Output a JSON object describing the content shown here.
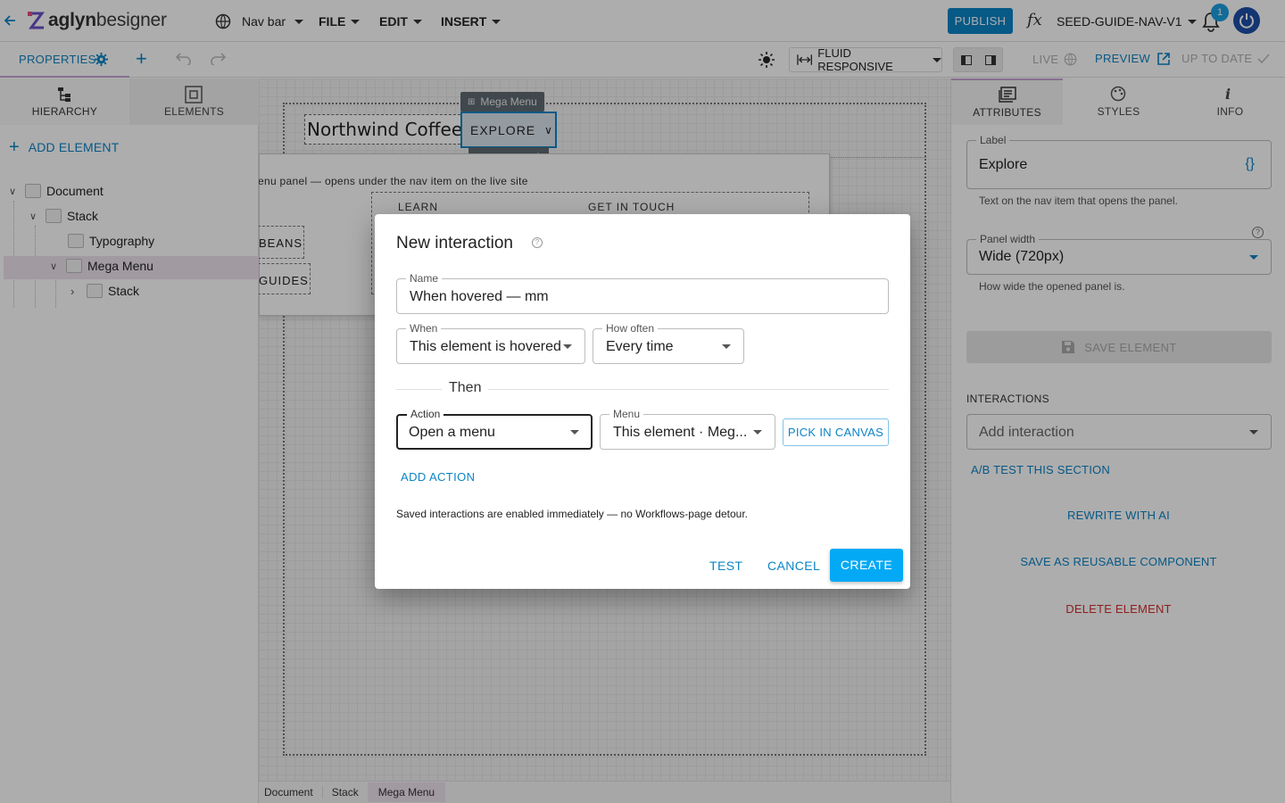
{
  "topbar": {
    "logo_prefix": "aglyn",
    "logo_suffix": "besigner",
    "page_menu": "Nav bar",
    "file": "FILE",
    "edit": "EDIT",
    "insert": "INSERT",
    "publish": "PUBLISH",
    "project": "SEED-GUIDE-NAV-V1",
    "notification_count": "1"
  },
  "toolbar": {
    "properties_tab": "PROPERTIES",
    "responsive_mode": "FLUID RESPONSIVE",
    "live": "LIVE",
    "preview": "PREVIEW",
    "status": "UP TO DATE"
  },
  "left_panel": {
    "tabs": [
      "HIERARCHY",
      "ELEMENTS"
    ],
    "add_element": "ADD ELEMENT",
    "tree": [
      {
        "label": "Document"
      },
      {
        "label": "Stack"
      },
      {
        "label": "Typography"
      },
      {
        "label": "Mega Menu"
      },
      {
        "label": "Stack"
      }
    ]
  },
  "canvas": {
    "brand": "Northwind Coffee",
    "nav_item": "EXPLORE",
    "selection_tag": "Mega Menu",
    "panel_caption": "enu panel — opens under the nav item on the live site",
    "col_learn": "LEARN",
    "col_contact": "GET IN TOUCH",
    "btn_beans": "BEANS",
    "btn_guides": "GUIDES"
  },
  "breadcrumb": [
    "Document",
    "Stack",
    "Mega Menu"
  ],
  "right_panel": {
    "tabs": [
      "ATTRIBUTES",
      "STYLES",
      "INFO"
    ],
    "label_field": {
      "label": "Label",
      "value": "Explore",
      "help": "Text on the nav item that opens the panel."
    },
    "width_field": {
      "label": "Panel width",
      "value": "Wide (720px)",
      "help": "How wide the opened panel is."
    },
    "save_element": "SAVE ELEMENT",
    "interactions_heading": "INTERACTIONS",
    "add_interaction": "Add interaction",
    "ab_test": "A/B TEST THIS SECTION",
    "rewrite_ai": "REWRITE WITH AI",
    "save_reusable": "SAVE AS REUSABLE COMPONENT",
    "delete": "DELETE ELEMENT"
  },
  "dialog": {
    "title": "New interaction",
    "name": {
      "label": "Name",
      "value": "When hovered — mm"
    },
    "when": {
      "label": "When",
      "value": "This element is hovered"
    },
    "how_often": {
      "label": "How often",
      "value": "Every time"
    },
    "then": "Then",
    "action": {
      "label": "Action",
      "value": "Open a menu"
    },
    "menu": {
      "label": "Menu",
      "value": "This element · Meg..."
    },
    "pick_in_canvas": "PICK IN CANVAS",
    "add_action": "ADD ACTION",
    "note": "Saved interactions are enabled immediately — no Workflows-page detour.",
    "test": "TEST",
    "cancel": "CANCEL",
    "create": "CREATE"
  },
  "colors": {
    "accent": "#0b84c6",
    "primary_button": "#03a9f4",
    "danger": "#d32f2f",
    "highlight": "#ede3ee"
  }
}
